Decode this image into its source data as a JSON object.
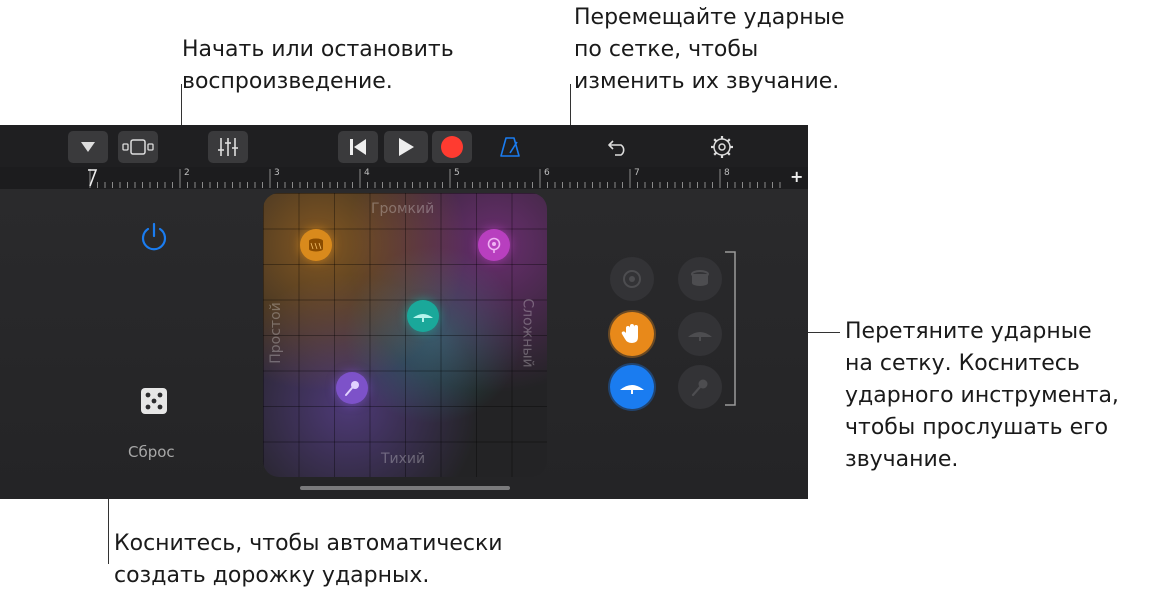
{
  "callouts": {
    "play": "Начать или остановить воспроизведение.",
    "grid": "Перемещайте ударные по сетке, чтобы изменить их звучание.",
    "drag": "Перетяните ударные на сетку. Коснитесь ударного инструмента, чтобы прослушать его звучание.",
    "reset": "Коснитесь, чтобы автоматически создать дорожку ударных."
  },
  "callout_lines": {
    "play": [
      "Начать или остановить",
      "воспроизведение."
    ],
    "grid": [
      "Перемещайте ударные",
      "по сетке, чтобы",
      "изменить их звучание."
    ],
    "drag": [
      "Перетяните ударные",
      "на сетку. Коснитесь",
      "ударного инструмента,",
      "чтобы прослушать его",
      "звучание."
    ],
    "reset": [
      "Коснитесь, чтобы автоматически",
      "создать дорожку ударных."
    ]
  },
  "toolbar": {
    "icons": [
      "triangle-down-icon",
      "tracks-view-icon",
      "mixer-icon",
      "rewind-icon",
      "play-icon",
      "record-icon",
      "metronome-icon",
      "undo-icon",
      "settings-icon"
    ]
  },
  "ruler": {
    "marks": [
      "1",
      "2",
      "3",
      "4",
      "5",
      "6",
      "7",
      "8"
    ],
    "add_label": "+"
  },
  "grid": {
    "top_label": "Громкий",
    "bottom_label": "Тихий",
    "left_label": "Простой",
    "right_label": "Сложный",
    "drums": [
      {
        "name": "snare-drum",
        "color": "#d98a1c"
      },
      {
        "name": "hihat-cymbal",
        "color": "#1aa89a"
      },
      {
        "name": "tambourine",
        "color": "#b83fbf"
      },
      {
        "name": "shaker",
        "color": "#7d52c9"
      }
    ]
  },
  "reset": {
    "label": "Сброс"
  },
  "colors": {
    "accent_blue": "#1a7cf0",
    "record_red": "#ff3b30",
    "clap_orange": "#e8891a"
  }
}
